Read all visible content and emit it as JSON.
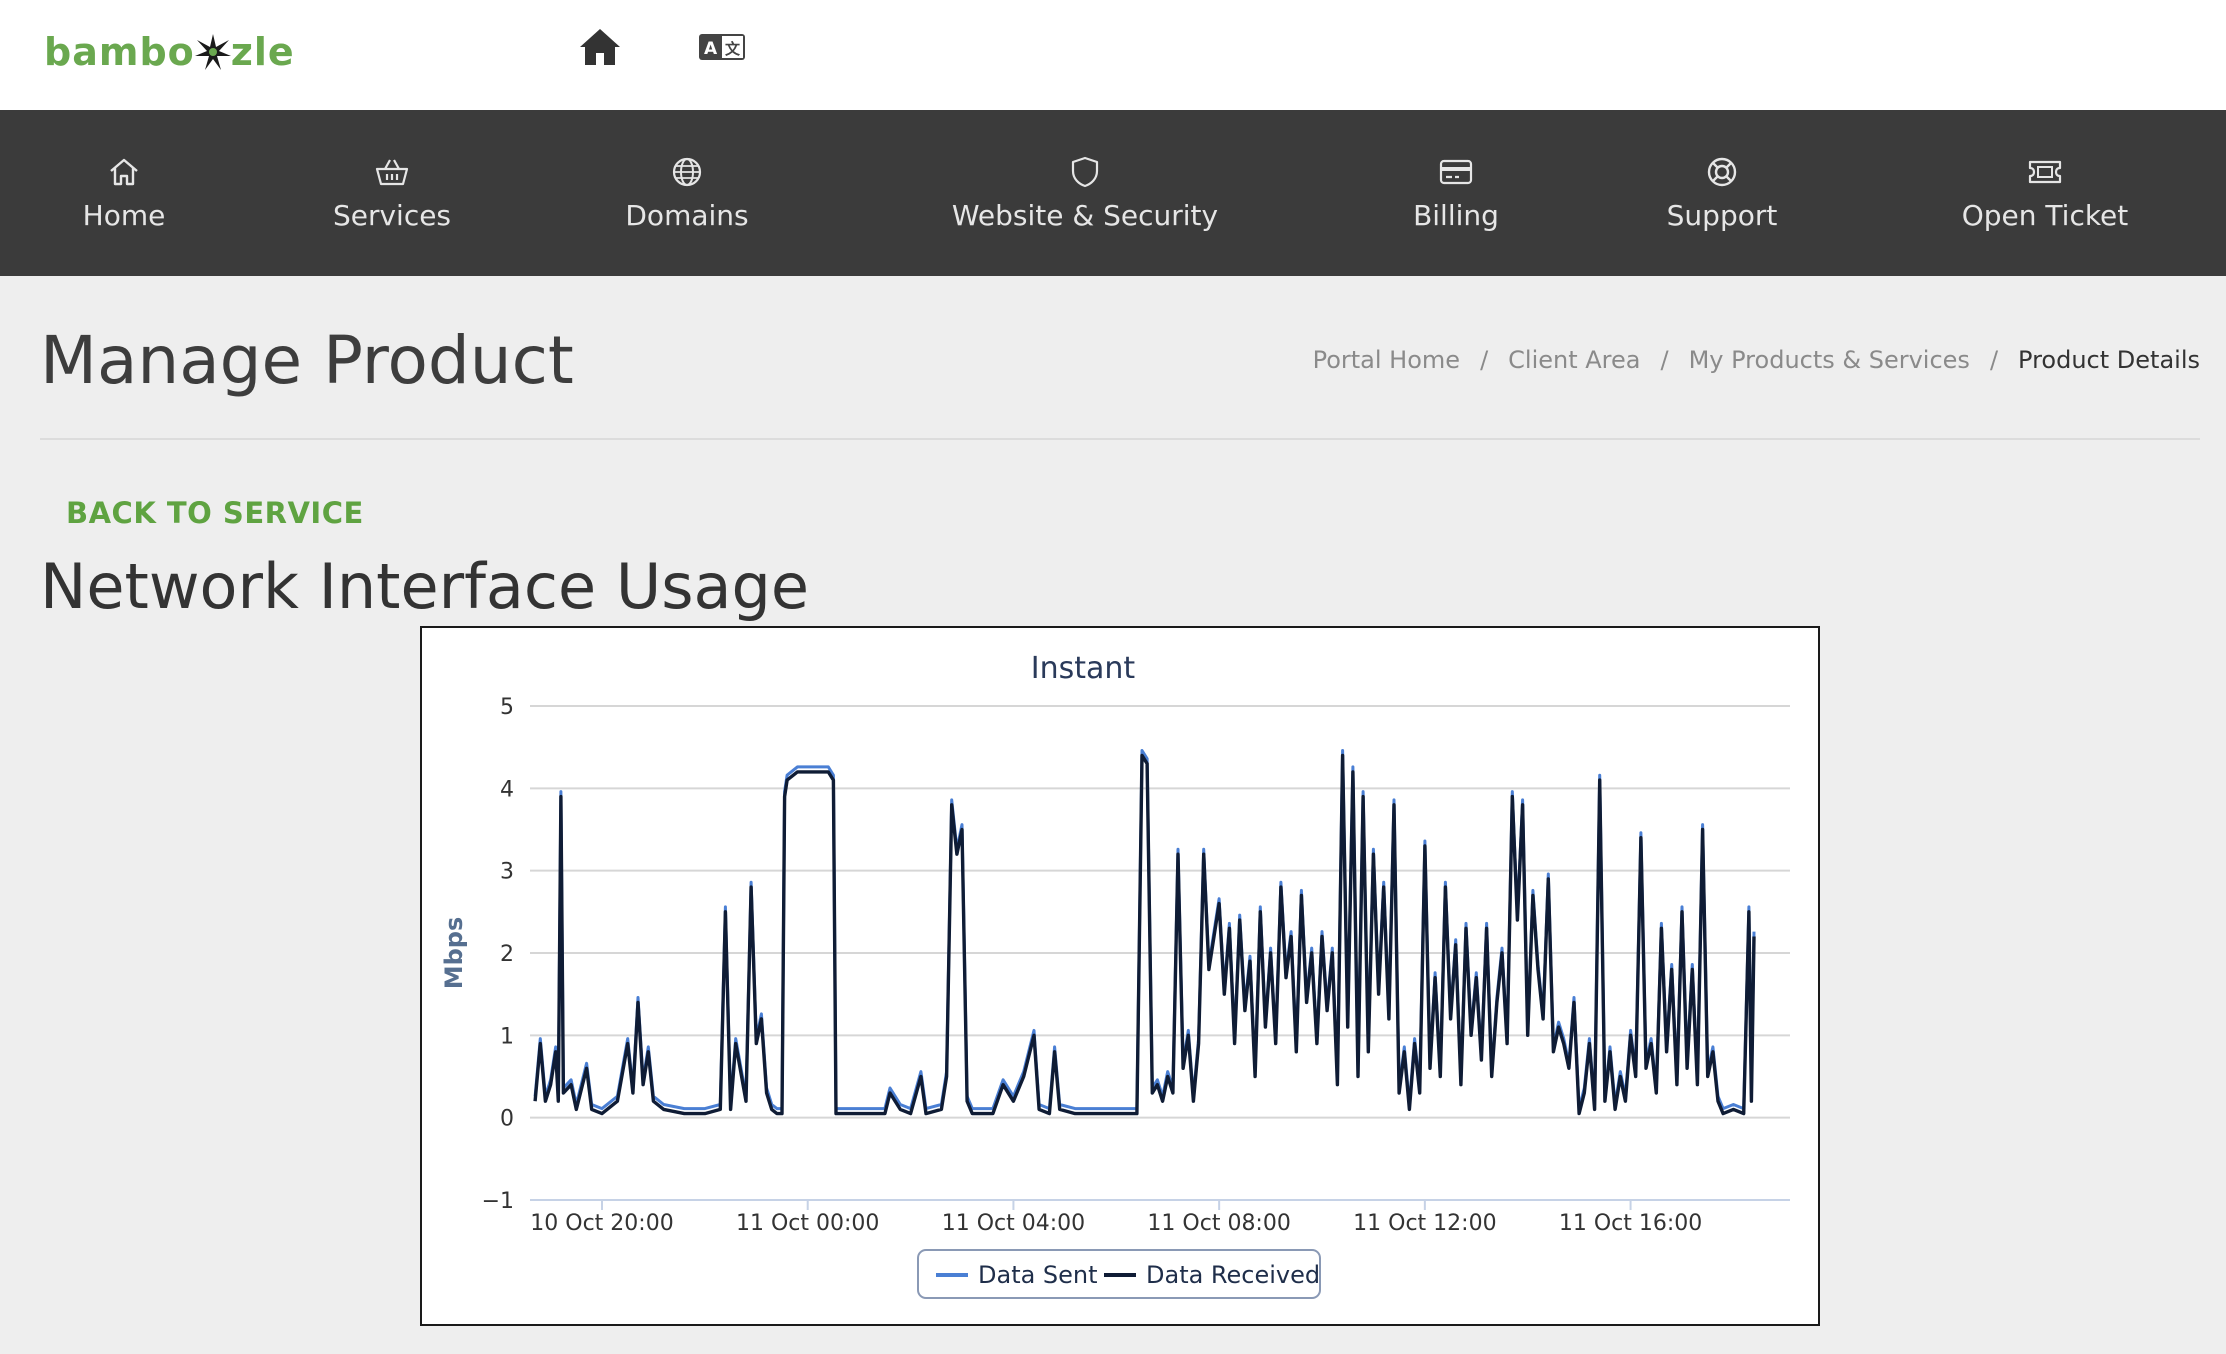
{
  "brand": {
    "logo_text_left": "bambo",
    "logo_text_right": "zle",
    "accent": "#6aa84f"
  },
  "topbar": {
    "icons": [
      "home-icon",
      "translate-icon"
    ]
  },
  "nav": {
    "items": [
      {
        "label": "Home",
        "icon": "home-outline-icon"
      },
      {
        "label": "Services",
        "icon": "basket-icon"
      },
      {
        "label": "Domains",
        "icon": "globe-icon"
      },
      {
        "label": "Website & Security",
        "icon": "shield-icon"
      },
      {
        "label": "Billing",
        "icon": "credit-card-icon"
      },
      {
        "label": "Support",
        "icon": "lifebuoy-icon"
      },
      {
        "label": "Open Ticket",
        "icon": "ticket-icon"
      }
    ]
  },
  "page": {
    "title": "Manage Product",
    "back_link": "BACK TO SERVICE",
    "section_title": "Network Interface Usage"
  },
  "breadcrumb": [
    {
      "label": "Portal Home"
    },
    {
      "label": "Client Area"
    },
    {
      "label": "My Products & Services"
    },
    {
      "label": "Product Details",
      "active": true
    }
  ],
  "chart_data": {
    "type": "line",
    "title": "Instant",
    "ylabel": "Mbps",
    "ylim": [
      -1,
      5
    ],
    "yticks": [
      "5",
      "4",
      "3",
      "2",
      "1",
      "0",
      "−1"
    ],
    "xticks": [
      "10 Oct 20:00",
      "11 Oct 00:00",
      "11 Oct 04:00",
      "11 Oct 08:00",
      "11 Oct 12:00",
      "11 Oct 16:00"
    ],
    "x_hours_range": [
      18.6,
      43.1
    ],
    "legend": "bottom-center",
    "series": [
      {
        "name": "Data Sent",
        "color": "#4a7fd4"
      },
      {
        "name": "Data Received",
        "color": "#0f1c35"
      }
    ],
    "received_points": [
      [
        18.7,
        0.2
      ],
      [
        18.8,
        0.9
      ],
      [
        18.9,
        0.2
      ],
      [
        19.0,
        0.4
      ],
      [
        19.1,
        0.8
      ],
      [
        19.15,
        0.2
      ],
      [
        19.2,
        3.9
      ],
      [
        19.25,
        0.3
      ],
      [
        19.4,
        0.4
      ],
      [
        19.5,
        0.1
      ],
      [
        19.7,
        0.6
      ],
      [
        19.8,
        0.1
      ],
      [
        20.0,
        0.05
      ],
      [
        20.3,
        0.2
      ],
      [
        20.5,
        0.9
      ],
      [
        20.6,
        0.3
      ],
      [
        20.7,
        1.4
      ],
      [
        20.8,
        0.4
      ],
      [
        20.9,
        0.8
      ],
      [
        21.0,
        0.2
      ],
      [
        21.2,
        0.1
      ],
      [
        21.6,
        0.05
      ],
      [
        22.0,
        0.05
      ],
      [
        22.3,
        0.1
      ],
      [
        22.4,
        2.5
      ],
      [
        22.5,
        0.1
      ],
      [
        22.6,
        0.9
      ],
      [
        22.8,
        0.2
      ],
      [
        22.9,
        2.8
      ],
      [
        23.0,
        0.9
      ],
      [
        23.1,
        1.2
      ],
      [
        23.2,
        0.3
      ],
      [
        23.3,
        0.1
      ],
      [
        23.4,
        0.05
      ],
      [
        23.5,
        0.05
      ],
      [
        23.55,
        3.9
      ],
      [
        23.6,
        4.1
      ],
      [
        23.8,
        4.2
      ],
      [
        24.0,
        4.2
      ],
      [
        24.2,
        4.2
      ],
      [
        24.4,
        4.2
      ],
      [
        24.5,
        4.1
      ],
      [
        24.55,
        0.05
      ],
      [
        24.8,
        0.05
      ],
      [
        25.2,
        0.05
      ],
      [
        25.5,
        0.05
      ],
      [
        25.6,
        0.3
      ],
      [
        25.8,
        0.1
      ],
      [
        26.0,
        0.05
      ],
      [
        26.2,
        0.5
      ],
      [
        26.3,
        0.05
      ],
      [
        26.6,
        0.1
      ],
      [
        26.7,
        0.5
      ],
      [
        26.8,
        3.8
      ],
      [
        26.9,
        3.2
      ],
      [
        27.0,
        3.5
      ],
      [
        27.1,
        0.2
      ],
      [
        27.2,
        0.05
      ],
      [
        27.6,
        0.05
      ],
      [
        27.8,
        0.4
      ],
      [
        28.0,
        0.2
      ],
      [
        28.2,
        0.5
      ],
      [
        28.4,
        1.0
      ],
      [
        28.5,
        0.1
      ],
      [
        28.7,
        0.05
      ],
      [
        28.8,
        0.8
      ],
      [
        28.9,
        0.1
      ],
      [
        29.2,
        0.05
      ],
      [
        29.6,
        0.05
      ],
      [
        30.0,
        0.05
      ],
      [
        30.4,
        0.05
      ],
      [
        30.5,
        4.4
      ],
      [
        30.6,
        4.3
      ],
      [
        30.7,
        0.3
      ],
      [
        30.8,
        0.4
      ],
      [
        30.9,
        0.2
      ],
      [
        31.0,
        0.5
      ],
      [
        31.1,
        0.3
      ],
      [
        31.2,
        3.2
      ],
      [
        31.3,
        0.6
      ],
      [
        31.4,
        1.0
      ],
      [
        31.5,
        0.2
      ],
      [
        31.6,
        0.9
      ],
      [
        31.7,
        3.2
      ],
      [
        31.8,
        1.8
      ],
      [
        31.9,
        2.2
      ],
      [
        32.0,
        2.6
      ],
      [
        32.1,
        1.5
      ],
      [
        32.2,
        2.3
      ],
      [
        32.3,
        0.9
      ],
      [
        32.4,
        2.4
      ],
      [
        32.5,
        1.3
      ],
      [
        32.6,
        1.9
      ],
      [
        32.7,
        0.5
      ],
      [
        32.8,
        2.5
      ],
      [
        32.9,
        1.1
      ],
      [
        33.0,
        2.0
      ],
      [
        33.1,
        0.9
      ],
      [
        33.2,
        2.8
      ],
      [
        33.3,
        1.7
      ],
      [
        33.4,
        2.2
      ],
      [
        33.5,
        0.8
      ],
      [
        33.6,
        2.7
      ],
      [
        33.7,
        1.4
      ],
      [
        33.8,
        2.0
      ],
      [
        33.9,
        0.9
      ],
      [
        34.0,
        2.2
      ],
      [
        34.1,
        1.3
      ],
      [
        34.2,
        2.0
      ],
      [
        34.3,
        0.4
      ],
      [
        34.4,
        4.4
      ],
      [
        34.5,
        1.1
      ],
      [
        34.6,
        4.2
      ],
      [
        34.7,
        0.5
      ],
      [
        34.8,
        3.9
      ],
      [
        34.9,
        0.8
      ],
      [
        35.0,
        3.2
      ],
      [
        35.1,
        1.5
      ],
      [
        35.2,
        2.8
      ],
      [
        35.3,
        1.2
      ],
      [
        35.4,
        3.8
      ],
      [
        35.5,
        0.3
      ],
      [
        35.6,
        0.8
      ],
      [
        35.7,
        0.1
      ],
      [
        35.8,
        0.9
      ],
      [
        35.9,
        0.3
      ],
      [
        36.0,
        3.3
      ],
      [
        36.1,
        0.6
      ],
      [
        36.2,
        1.7
      ],
      [
        36.3,
        0.5
      ],
      [
        36.4,
        2.8
      ],
      [
        36.5,
        1.2
      ],
      [
        36.6,
        2.1
      ],
      [
        36.7,
        0.4
      ],
      [
        36.8,
        2.3
      ],
      [
        36.9,
        1.0
      ],
      [
        37.0,
        1.7
      ],
      [
        37.1,
        0.7
      ],
      [
        37.2,
        2.3
      ],
      [
        37.3,
        0.5
      ],
      [
        37.4,
        1.4
      ],
      [
        37.5,
        2.0
      ],
      [
        37.6,
        0.9
      ],
      [
        37.7,
        3.9
      ],
      [
        37.8,
        2.4
      ],
      [
        37.9,
        3.8
      ],
      [
        38.0,
        1.0
      ],
      [
        38.1,
        2.7
      ],
      [
        38.2,
        1.8
      ],
      [
        38.3,
        1.2
      ],
      [
        38.4,
        2.9
      ],
      [
        38.5,
        0.8
      ],
      [
        38.6,
        1.1
      ],
      [
        38.7,
        0.9
      ],
      [
        38.8,
        0.6
      ],
      [
        38.9,
        1.4
      ],
      [
        39.0,
        0.05
      ],
      [
        39.1,
        0.3
      ],
      [
        39.2,
        0.9
      ],
      [
        39.3,
        0.1
      ],
      [
        39.4,
        4.1
      ],
      [
        39.5,
        0.2
      ],
      [
        39.6,
        0.8
      ],
      [
        39.7,
        0.1
      ],
      [
        39.8,
        0.5
      ],
      [
        39.9,
        0.2
      ],
      [
        40.0,
        1.0
      ],
      [
        40.1,
        0.5
      ],
      [
        40.2,
        3.4
      ],
      [
        40.3,
        0.6
      ],
      [
        40.4,
        0.9
      ],
      [
        40.5,
        0.3
      ],
      [
        40.6,
        2.3
      ],
      [
        40.7,
        0.8
      ],
      [
        40.8,
        1.8
      ],
      [
        40.9,
        0.4
      ],
      [
        41.0,
        2.5
      ],
      [
        41.1,
        0.6
      ],
      [
        41.2,
        1.8
      ],
      [
        41.3,
        0.4
      ],
      [
        41.4,
        3.5
      ],
      [
        41.5,
        0.5
      ],
      [
        41.6,
        0.8
      ],
      [
        41.7,
        0.2
      ],
      [
        41.8,
        0.05
      ],
      [
        42.0,
        0.1
      ],
      [
        42.2,
        0.05
      ],
      [
        42.3,
        2.5
      ],
      [
        42.35,
        0.2
      ],
      [
        42.4,
        2.2
      ]
    ]
  }
}
